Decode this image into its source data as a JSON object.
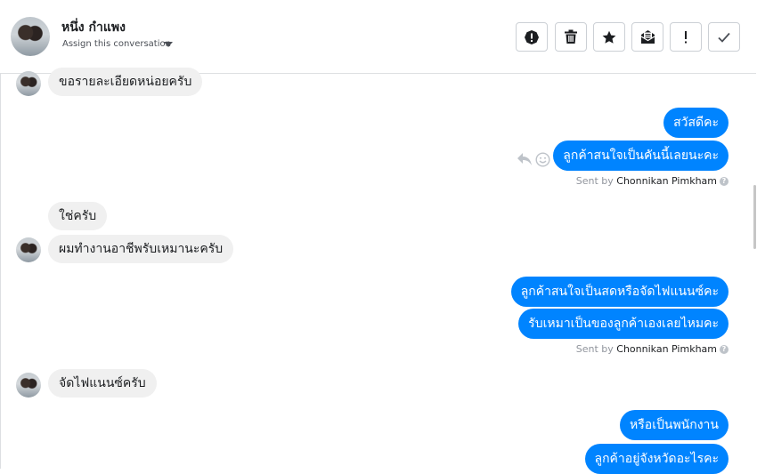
{
  "header": {
    "contact_name": "หนึ่ง กำแพง",
    "assign_label": "Assign this conversation",
    "actions": [
      {
        "icon": "alert-circle-icon",
        "label": "Mark as spam"
      },
      {
        "icon": "trash-icon",
        "label": "Delete"
      },
      {
        "icon": "star-icon",
        "label": "Star"
      },
      {
        "icon": "mark-unread-icon",
        "label": "Mark as unread"
      },
      {
        "icon": "exclamation-icon",
        "label": "Follow up"
      },
      {
        "icon": "checkmark-icon",
        "label": "Done"
      }
    ]
  },
  "messages": {
    "m1": "ขอรายละเอียดหน่อยครับ",
    "m2": "สวัสดีคะ",
    "m3": "ลูกค้าสนใจเป็นคันนี้เลยนะคะ",
    "sent1_prefix": "Sent by",
    "sent1_name": "Chonnikan Pimkham",
    "m4": "ใช่ครับ",
    "m5": "ผมทำงานอาชีพรับเหมานะครับ",
    "m6": "ลูกค้าสนใจเป็นสดหรือจัดไฟแนนซ์คะ",
    "m7": "รับเหมาเป็นของลูกค้าเองเลยไหมคะ",
    "sent2_prefix": "Sent by",
    "sent2_name": "Chonnikan Pimkham",
    "m8": "จัดไฟแนนซ์ครับ",
    "m9": "หรือเป็นพนักงาน",
    "m10": "ลูกค้าอยู่จังหวัดอะไรคะ"
  },
  "colors": {
    "outgoing_bubble": "#0084ff",
    "incoming_bubble": "#f0f0f0"
  }
}
